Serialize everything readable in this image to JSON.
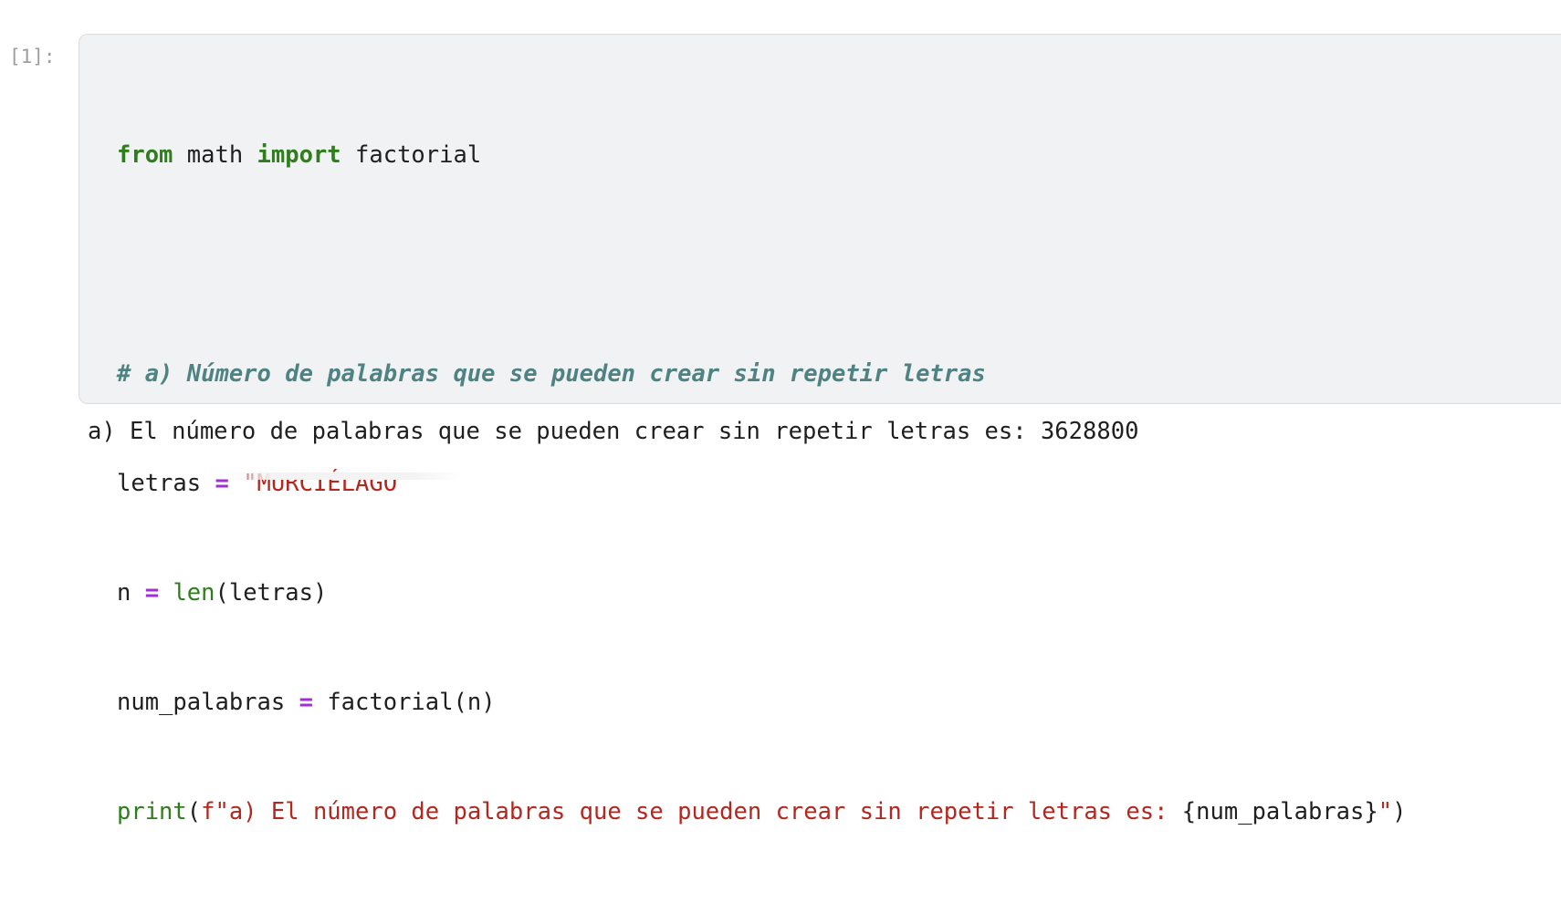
{
  "cell": {
    "prompt": "[1]:",
    "code": {
      "l1": {
        "kw1": "from",
        "mod": " math ",
        "kw2": "import",
        "name": " factorial"
      },
      "l3": {
        "comment": "# a) Número de palabras que se pueden crear sin repetir letras"
      },
      "l4": {
        "var": "letras ",
        "op": "=",
        "sp": " ",
        "str": "\"MURCIÉLAGO\""
      },
      "l5": {
        "var": "n ",
        "op": "=",
        "sp": " ",
        "fn": "len",
        "args": "(letras)"
      },
      "l6": {
        "var": "num_palabras ",
        "op": "=",
        "sp": " ",
        "call": "factorial(n)"
      },
      "l7": {
        "fn": "print",
        "open": "(",
        "str_start": "f\"a) El número de palabras que se pueden crear sin repetir letras es: ",
        "interp": "{num_palabras}",
        "str_end": "\"",
        "close": ")"
      }
    },
    "output": "a) El número de palabras que se pueden crear sin repetir letras es: 3628800"
  }
}
